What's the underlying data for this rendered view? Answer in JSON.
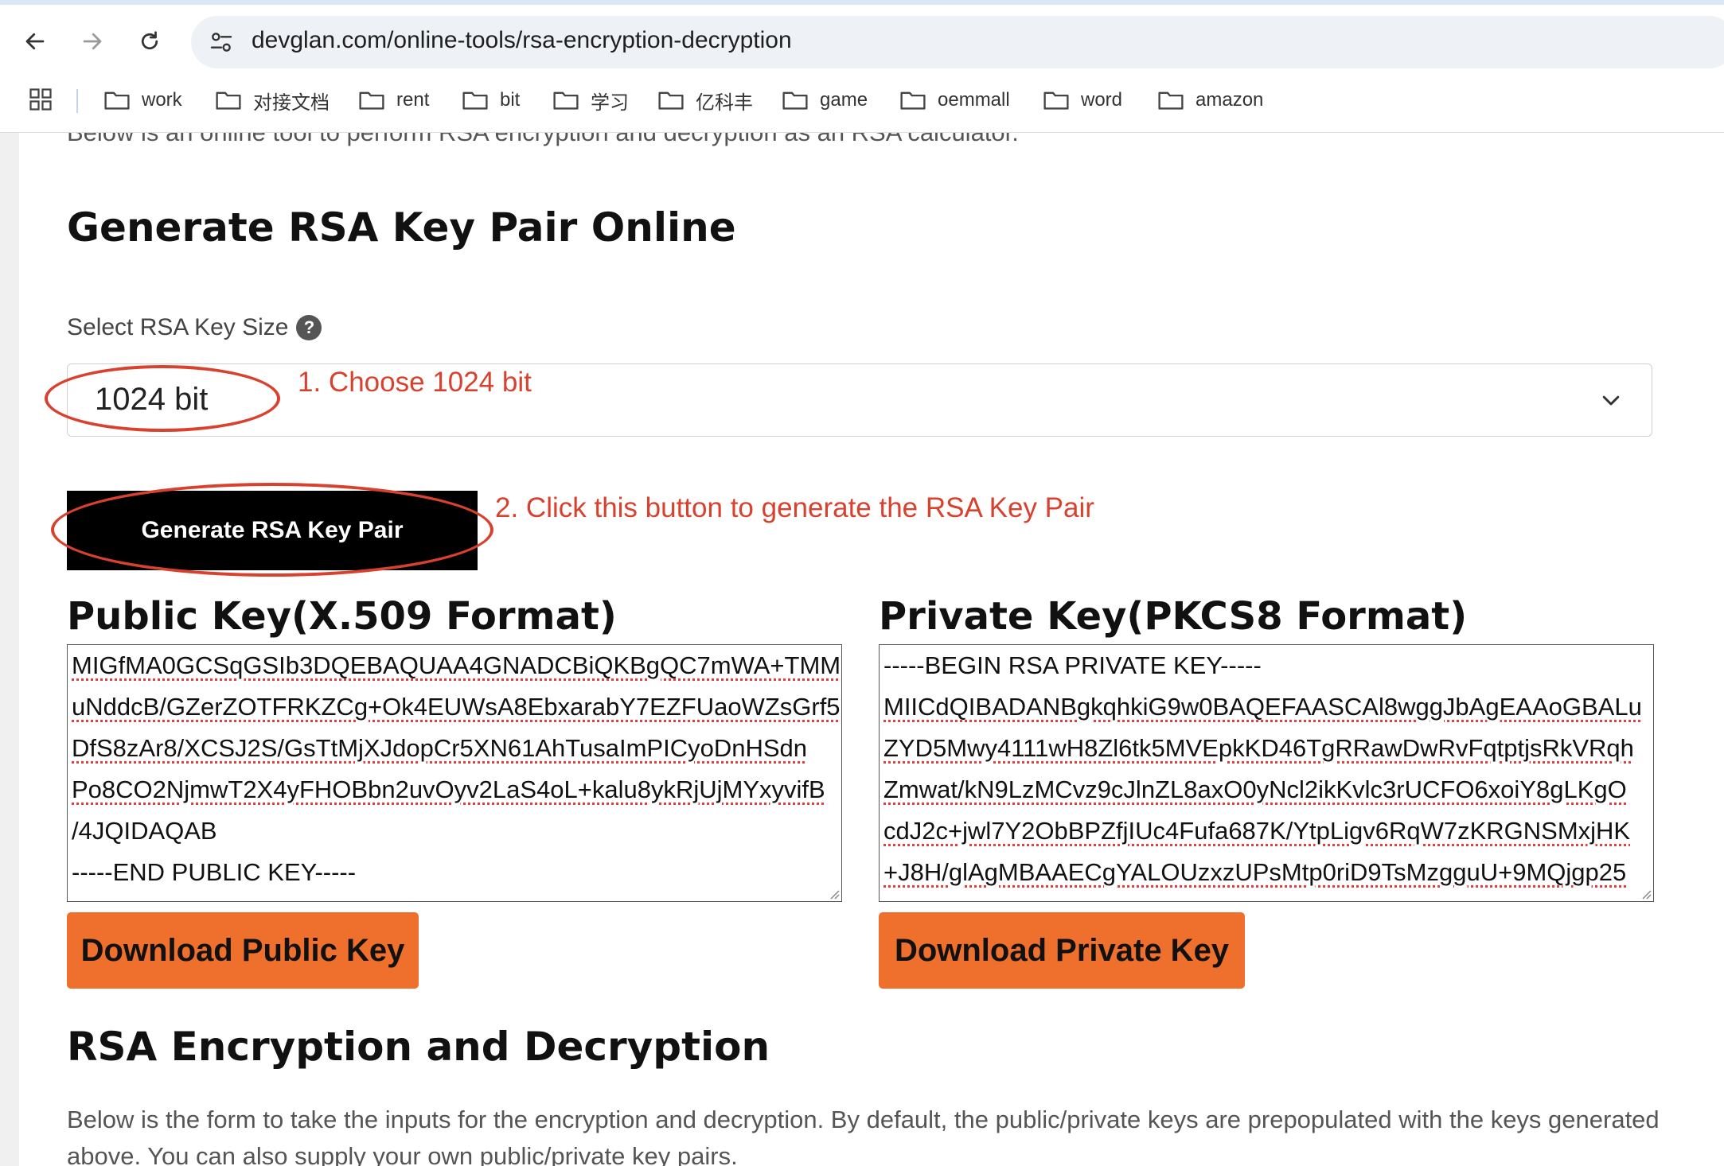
{
  "browser": {
    "url": "devglan.com/online-tools/rsa-encryption-decryption",
    "bookmarks": [
      "work",
      "对接文档",
      "rent",
      "bit",
      "学习",
      "亿科丰",
      "game",
      "oemmall",
      "word",
      "amazon"
    ]
  },
  "page": {
    "intro_cut": "Below is an online tool to perform RSA encryption and decryption as an RSA calculator.",
    "heading": "Generate RSA Key Pair Online",
    "key_size_label": "Select RSA Key Size",
    "key_size_value": "1024 bit",
    "generate_button": "Generate RSA Key Pair",
    "public_key_title": "Public Key(X.509 Format)",
    "private_key_title": "Private Key(PKCS8 Format)",
    "public_key_lines": [
      "MIGfMA0GCSqGSIb3DQEBAQUAA4GNADCBiQKBgQC7mWA+TMM",
      "uNddcB/GZerZOTFRKZCg+Ok4EUWsA8EbxarabY7EZFUaoWZsGrf5",
      "DfS8zAr8/XCSJ2S/GsTtMjXJdopCr5XN61AhTusaImPICyoDnHSdn",
      "Po8CO2NjmwT2X4yFHOBbn2uvOyv2LaS4oL+kalu8ykRjUjMYxyvifB",
      "/4JQIDAQAB",
      "-----END PUBLIC KEY-----"
    ],
    "private_key_lines": [
      "-----BEGIN RSA PRIVATE KEY-----",
      "MIICdQIBADANBgkqhkiG9w0BAQEFAASCAl8wggJbAgEAAoGBALu",
      "ZYD5Mwy4111wH8Zl6tk5MVEpkKD46TgRRawDwRvFqtptjsRkVRqh",
      "Zmwat/kN9LzMCvz9cJlnZL8axO0yNcl2ikKvlc3rUCFO6xoiY8gLKgO",
      "cdJ2c+jwl7Y2ObBPZfjIUc4Fufa687K/YtpLigv6RqW7zKRGNSMxjHK",
      "+J8H/glAgMBAAECgYALOUzxzUPsMtp0riD9TsMzgguU+9MQjgp25"
    ],
    "download_public": "Download Public Key",
    "download_private": "Download Private Key",
    "section_heading": "RSA Encryption and Decryption",
    "section_paragraph": "Below is the form to take the inputs for the encryption and decryption. By default, the public/private keys are prepopulated with the keys generated above. You can also supply your own public/private key pairs."
  },
  "annotations": {
    "step1": "1. Choose 1024 bit",
    "step2": "2. Click this button to generate the RSA Key Pair"
  },
  "colors": {
    "annotation": "#d9412f",
    "download_button": "#ee702c",
    "generate_button": "#000000"
  }
}
